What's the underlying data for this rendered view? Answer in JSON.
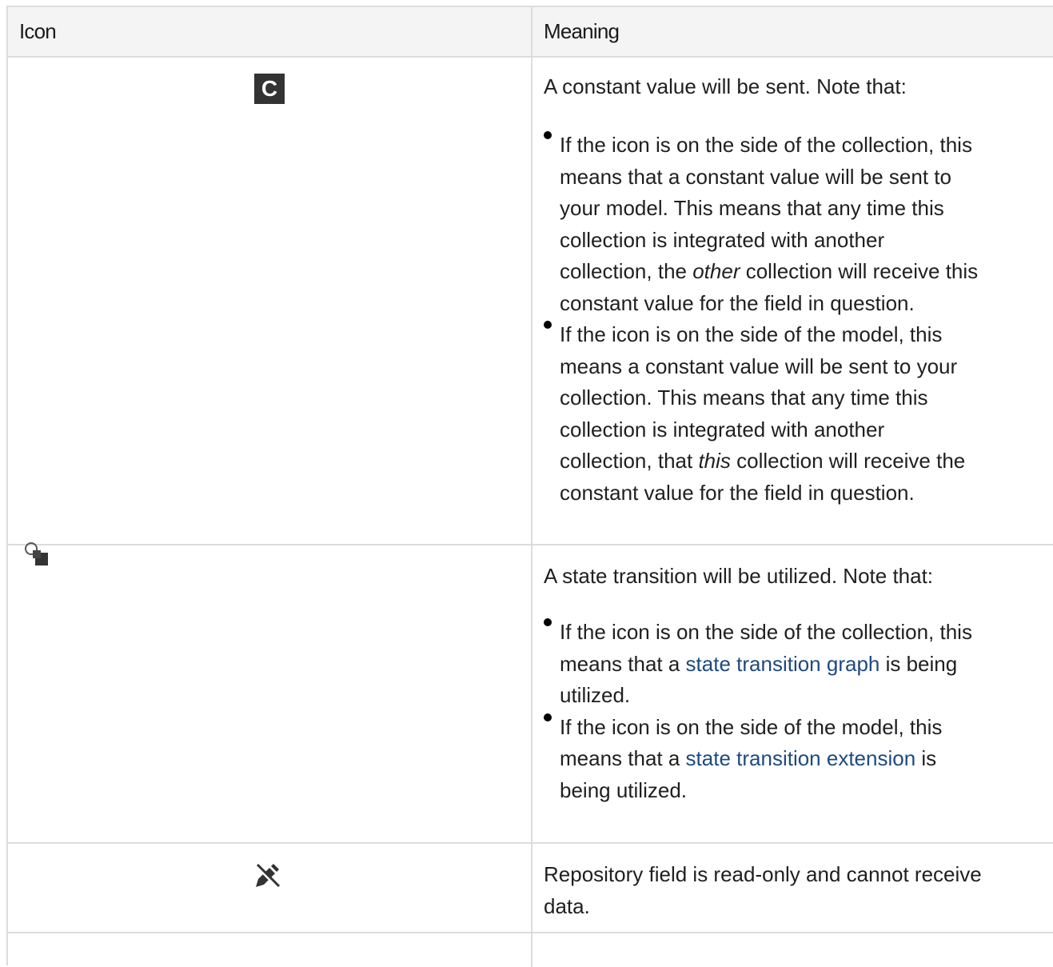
{
  "header": {
    "icon_col": "Icon",
    "meaning_col": "Meaning"
  },
  "rows": [
    {
      "icon": "constant-c-icon",
      "icon_glyph": "C",
      "intro": "A constant value will be sent. Note that:",
      "bullet1": {
        "line1": "If the icon is on the side of the collection, this",
        "line2": "means that a constant value will be sent to",
        "line3": "your model. This means that any time this",
        "line4": "collection is integrated with another",
        "line5_pre": "collection, the ",
        "line5_em": "other",
        "line5_post": " collection will receive this",
        "line6": "constant value for the field in question."
      },
      "bullet2": {
        "line1": "If the icon is on the side of the model, this",
        "line2": "means a constant value will be sent to your",
        "line3": "collection. This means that any time this",
        "line4": "collection is integrated with another",
        "line5_pre": "collection, that ",
        "line5_em": "this",
        "line5_post": " collection will receive the",
        "line6": "constant value for the field in question."
      }
    },
    {
      "icon": "state-transition-icon",
      "intro": "A state transition will be utilized. Note that:",
      "bullet1": {
        "line1": "If the icon is on the side of the collection, this",
        "line2_pre": "means that a ",
        "line2_link": "state transition graph",
        "line2_post": " is being",
        "line3": "utilized."
      },
      "bullet2": {
        "line1": "If the icon is on the side of the model, this",
        "line2_pre": "means that a ",
        "line2_link": "state transition extension",
        "line2_post": " is",
        "line3": "being utilized."
      }
    },
    {
      "icon": "pencil-off-icon",
      "text_line1": "Repository field is read-only and cannot receive",
      "text_line2": "data."
    }
  ],
  "colors": {
    "border": "#dcdcdc",
    "header_bg": "#f4f4f4",
    "link": "#1d4a80",
    "icon_dark": "#333333"
  }
}
